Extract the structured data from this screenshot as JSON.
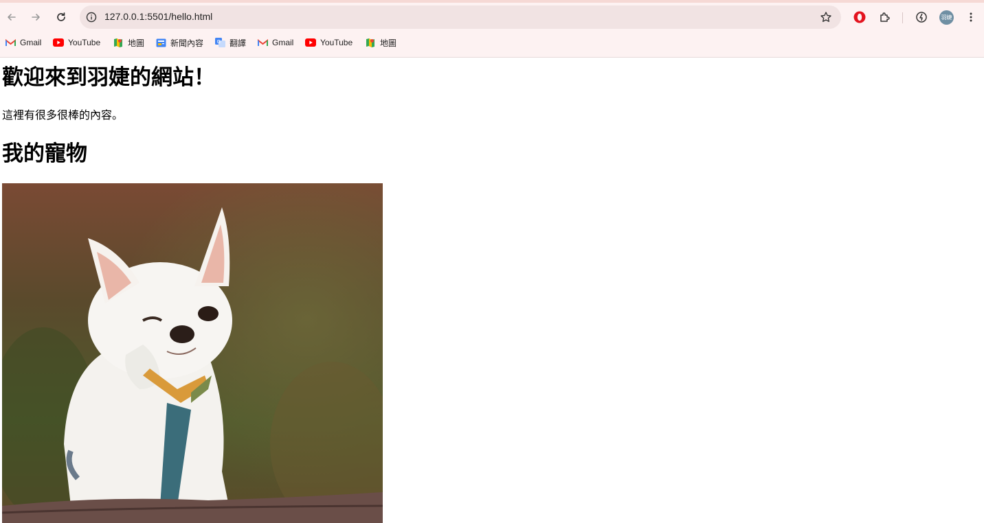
{
  "browser": {
    "url": "127.0.0.1:5501/hello.html",
    "profile_avatar_text": "羽婕",
    "bookmarks": [
      {
        "label": "Gmail",
        "icon": "gmail-icon"
      },
      {
        "label": "YouTube",
        "icon": "youtube-icon"
      },
      {
        "label": "地圖",
        "icon": "maps-icon"
      },
      {
        "label": "新聞內容",
        "icon": "news-icon"
      },
      {
        "label": "翻譯",
        "icon": "translate-icon"
      },
      {
        "label": "Gmail",
        "icon": "gmail-icon"
      },
      {
        "label": "YouTube",
        "icon": "youtube-icon"
      },
      {
        "label": "地圖",
        "icon": "maps-icon"
      }
    ]
  },
  "page": {
    "heading": "歡迎來到羽婕的網站！",
    "intro": "這裡有很多很棒的內容。",
    "pets_heading": "我的寵物",
    "pet_photo": "white chihuahua winking"
  },
  "colors": {
    "chrome_bg": "#fdf2f2",
    "omnibox_bg": "#f1e3e3"
  }
}
